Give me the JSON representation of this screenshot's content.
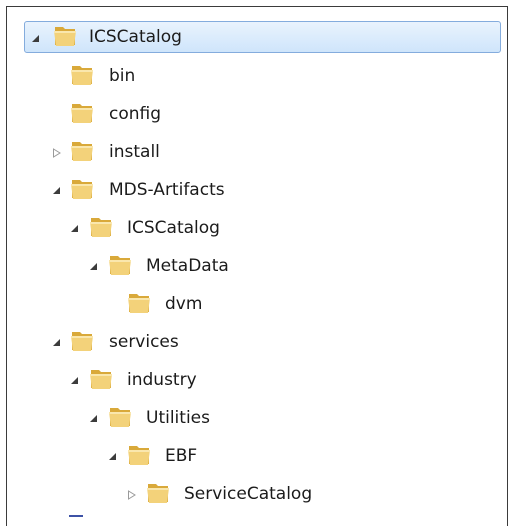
{
  "tree": [
    {
      "label": "ICSCatalog",
      "state": "expanded",
      "selected": true
    },
    {
      "label": "bin",
      "state": "leaf"
    },
    {
      "label": "config",
      "state": "leaf"
    },
    {
      "label": "install",
      "state": "collapsed"
    },
    {
      "label": "MDS-Artifacts",
      "state": "expanded"
    },
    {
      "label": "ICSCatalog",
      "state": "expanded"
    },
    {
      "label": "MetaData",
      "state": "expanded"
    },
    {
      "label": "dvm",
      "state": "leaf"
    },
    {
      "label": "services",
      "state": "expanded"
    },
    {
      "label": "industry",
      "state": "expanded"
    },
    {
      "label": "Utilities",
      "state": "expanded"
    },
    {
      "label": "EBF",
      "state": "expanded"
    },
    {
      "label": "ServiceCatalog",
      "state": "collapsed"
    }
  ]
}
